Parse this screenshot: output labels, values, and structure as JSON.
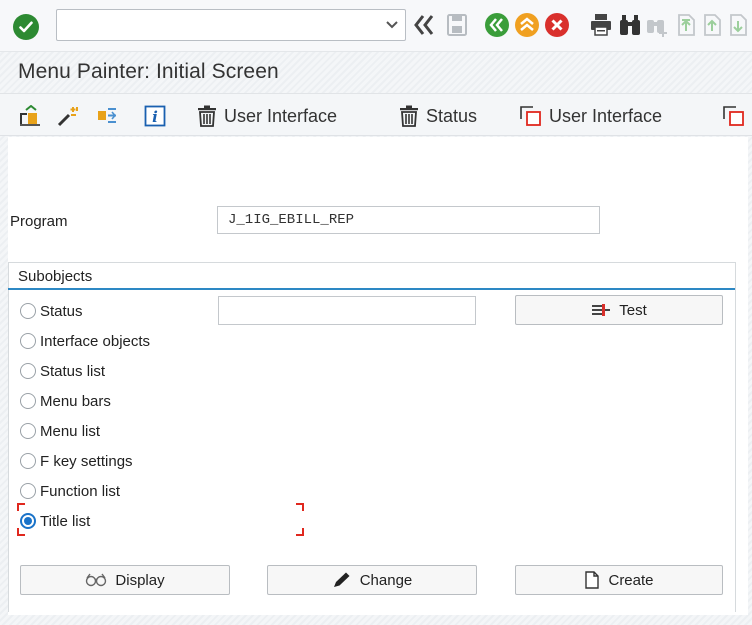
{
  "command_field": {
    "value": ""
  },
  "title": "Menu Painter: Initial Screen",
  "toolbar": {
    "buttons": [
      {
        "label": "User Interface",
        "icon": "trash-icon"
      },
      {
        "label": "Status",
        "icon": "trash-icon"
      },
      {
        "label": "User Interface",
        "icon": "copy-icon"
      }
    ]
  },
  "program": {
    "label": "Program",
    "value": "J_1IG_EBILL_REP"
  },
  "subobjects": {
    "title": "Subobjects",
    "options": [
      {
        "label": "Status",
        "selected": false
      },
      {
        "label": "Interface objects",
        "selected": false
      },
      {
        "label": "Status list",
        "selected": false
      },
      {
        "label": "Menu bars",
        "selected": false
      },
      {
        "label": "Menu list",
        "selected": false
      },
      {
        "label": "F key settings",
        "selected": false
      },
      {
        "label": "Function list",
        "selected": false
      },
      {
        "label": "Title list",
        "selected": true
      }
    ],
    "status_value": "",
    "test_label": "Test"
  },
  "actions": {
    "display": "Display",
    "change": "Change",
    "create": "Create"
  },
  "colors": {
    "accent": "#2d88c4",
    "ok": "#2d8a32",
    "back": "#3a9d3a",
    "exit": "#f0a020",
    "cancel": "#d9302c",
    "focus": "#e0281e"
  }
}
